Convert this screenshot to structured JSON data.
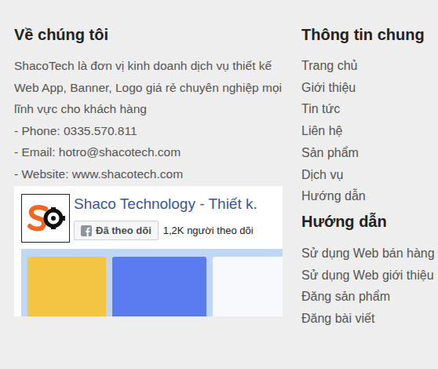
{
  "about": {
    "heading": "Về chúng tôi",
    "description": "ShacoTech là đơn vị kinh doanh dịch vụ thiết kế Web App, Banner, Logo giá rẻ chuyên nghiệp mọi lĩnh vực cho khách hàng",
    "contacts": [
      "- Phone: 0335.570.811",
      "- Email: hotro@shacotech.com",
      "- Website: www.shacotech.com"
    ]
  },
  "facebook": {
    "page_name": "Shaco Technology - Thiết k.",
    "button": "Đã theo dõi",
    "followers": "1,2K người theo dõi"
  },
  "info": {
    "heading": "Thông tin chung",
    "links": [
      "Trang chủ",
      "Giới thiệu",
      "Tin tức",
      "Liên hệ",
      "Sản phẩm",
      "Dịch vụ",
      "Hướng dẫn"
    ]
  },
  "guides": {
    "heading": "Hướng dẫn",
    "links": [
      "Sử dụng Web bán hàng",
      "Sử dụng Web giới thiệu",
      "Đăng sản phẩm",
      "Đăng bài viết"
    ]
  }
}
